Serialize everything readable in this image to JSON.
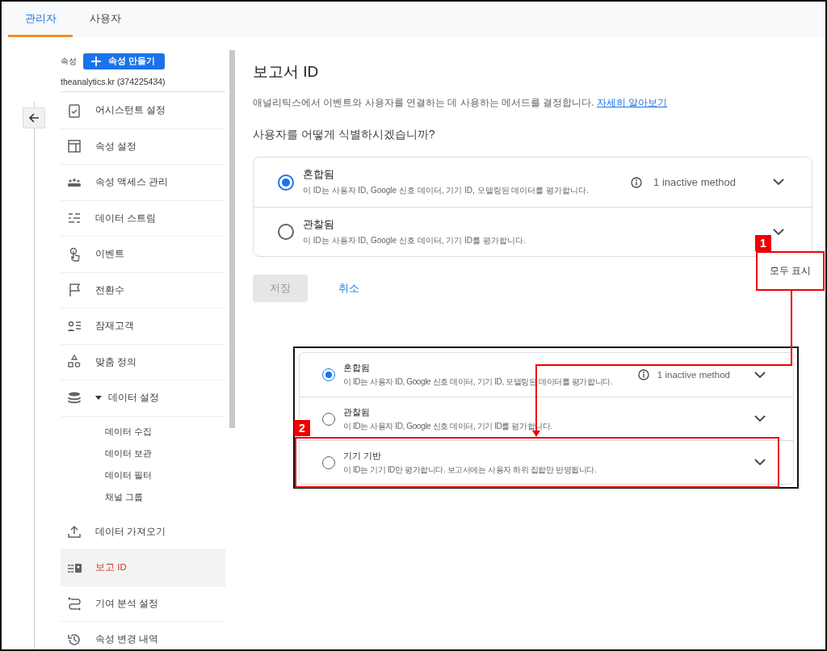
{
  "tabs": [
    {
      "label": "관리자",
      "selected": true
    },
    {
      "label": "사용자",
      "selected": false
    }
  ],
  "sidebar": {
    "property_label": "속성",
    "create_button": "속성 만들기",
    "account": "theanalytics.kr (374225434)",
    "items": [
      {
        "label": "어시스턴트 설정",
        "selected": false
      },
      {
        "label": "속성 설정",
        "selected": false
      },
      {
        "label": "속성 액세스 관리",
        "selected": false
      },
      {
        "label": "데이터 스트림",
        "selected": false
      },
      {
        "label": "이벤트",
        "selected": false
      },
      {
        "label": "전환수",
        "selected": false
      },
      {
        "label": "잠재고객",
        "selected": false
      },
      {
        "label": "맞춤 정의",
        "selected": false
      },
      {
        "label": "데이터 설정",
        "selected": false,
        "expanded": true,
        "children": [
          {
            "label": "데이터 수집",
            "selected": false
          },
          {
            "label": "데이터 보관",
            "selected": false
          },
          {
            "label": "데이터 필터",
            "selected": false
          },
          {
            "label": "채널 그룹",
            "selected": false
          }
        ]
      },
      {
        "label": "데이터 가져오기",
        "selected": false
      },
      {
        "label": "보고 ID",
        "selected": true
      },
      {
        "label": "기여 분석 설정",
        "selected": false
      },
      {
        "label": "속성 변경 내역",
        "selected": false
      }
    ]
  },
  "main": {
    "title": "보고서 ID",
    "description": "애널리틱스에서 이벤트와 사용자를 연결하는 데 사용하는 메서드를 결정합니다.",
    "learn_more_link": "자세히 알아보기",
    "question": "사용자를 어떻게 식별하시겠습니까?",
    "options": [
      {
        "title": "혼합됨",
        "description": "이 ID는 사용자 ID, Google 신호 데이터, 기기 ID, 모델링된 데이터를 평가합니다.",
        "selected": true,
        "note": "1 inactive method"
      },
      {
        "title": "관찰됨",
        "description": "이 ID는 사용자 ID, Google 신호 데이터, 기기 ID를 평가합니다.",
        "selected": false
      }
    ],
    "save_button": {
      "label": "저장",
      "disabled": true
    },
    "cancel_button": "취소"
  },
  "annotations": {
    "badge_1": "1",
    "show_all": "모두 표시",
    "badge_2": "2",
    "options": [
      {
        "title": "혼합됨",
        "description": "이 ID는 사용자 ID, Google 신호 데이터, 기기 ID, 모델링된 데이터를 평가합니다.",
        "selected": true,
        "note": "1 inactive method"
      },
      {
        "title": "관찰됨",
        "description": "이 ID는 사용자 ID, Google 신호 데이터, 기기 ID를 평가합니다.",
        "selected": false
      },
      {
        "title": "기기 기반",
        "description": "이 ID는 기기 ID만 평가합니다. 보고서에는 사용자 하위 집합만 반영됩니다.",
        "selected": false
      }
    ]
  }
}
